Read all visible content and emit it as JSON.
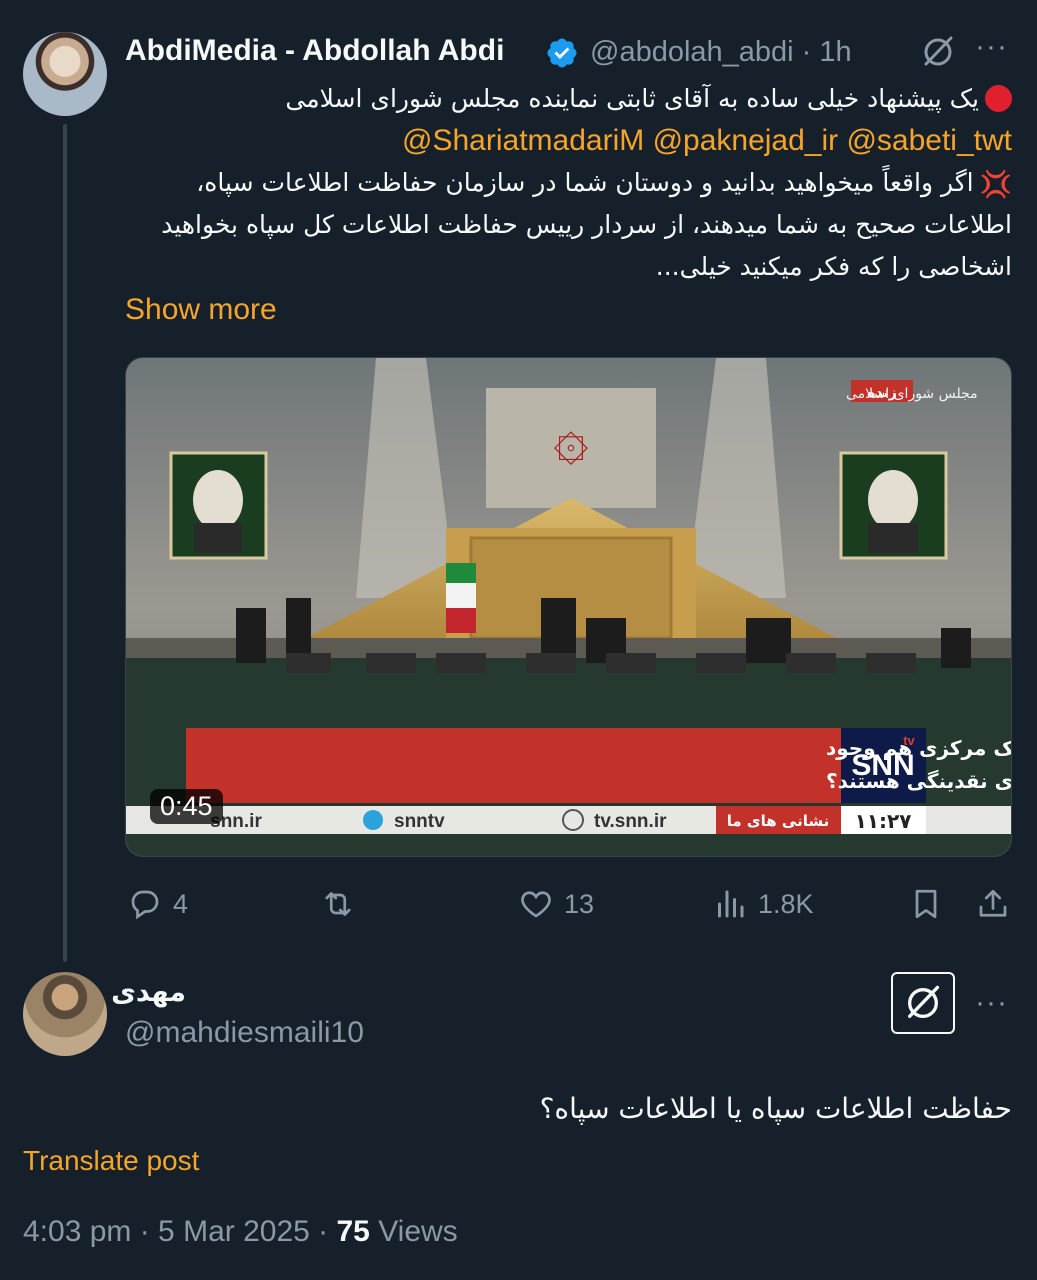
{
  "tweet": {
    "author_name": "AbdiMedia - Abdollah Abdi",
    "handle": "@abdolah_abdi",
    "age": "· 1h",
    "more": "···",
    "line1": "یک پیشنهاد خیلی ساده به آقای ثابتی نماینده مجلس شورای اسلامی",
    "mentions": "@ShariatmadariM @paknejad_ir @sabeti_twt",
    "line3": "اگر واقعاً میخواهید بدانید و دوستان شما در سازمان حفاظت اطلاعات سپاه،",
    "line4": "اطلاعات صحیح به شما میدهند، از سردار رییس حفاظت اطلاعات کل سپاه بخواهید",
    "line5": "اشخاصی را که فکر میکنید خیلی...",
    "show_more": "Show more",
    "video": {
      "duration": "0:45",
      "live_tag": "زنده",
      "channel_label": "مجلس شورای اسلامی",
      "ticker_line1": "قادری: ای کاش امکانی برای پاسخگویی رئیس کل بانک مرکزی هم وجود",
      "ticker_line2": "داشت، چرا با فروش سکه پیگیر جمع آوری نقدینگی هستند؟",
      "logo_text": "SNN",
      "logo_tv": "tv",
      "bar_left": "snn.ir",
      "bar_tg": "snntv",
      "bar_site": "tv.snn.ir",
      "bar_addresses": "نشانی های ما",
      "clock": "۱۱:۲۷"
    },
    "actions": {
      "replies": "4",
      "likes": "13",
      "views": "1.8K"
    }
  },
  "reply": {
    "name": "مهدی",
    "handle": "@mahdiesmaili10",
    "more": "···",
    "text": "حفاظت اطلاعات سپاه یا اطلاعات سپاه؟",
    "translate": "Translate post",
    "time": "4:03 pm · 5 Mar 2025 · ",
    "views_count": "75",
    "views_label": " Views"
  },
  "colors": {
    "background": "#15202b",
    "accent": "#f7a52a",
    "muted": "#8b98a5",
    "verified": "#1d9bf0"
  }
}
